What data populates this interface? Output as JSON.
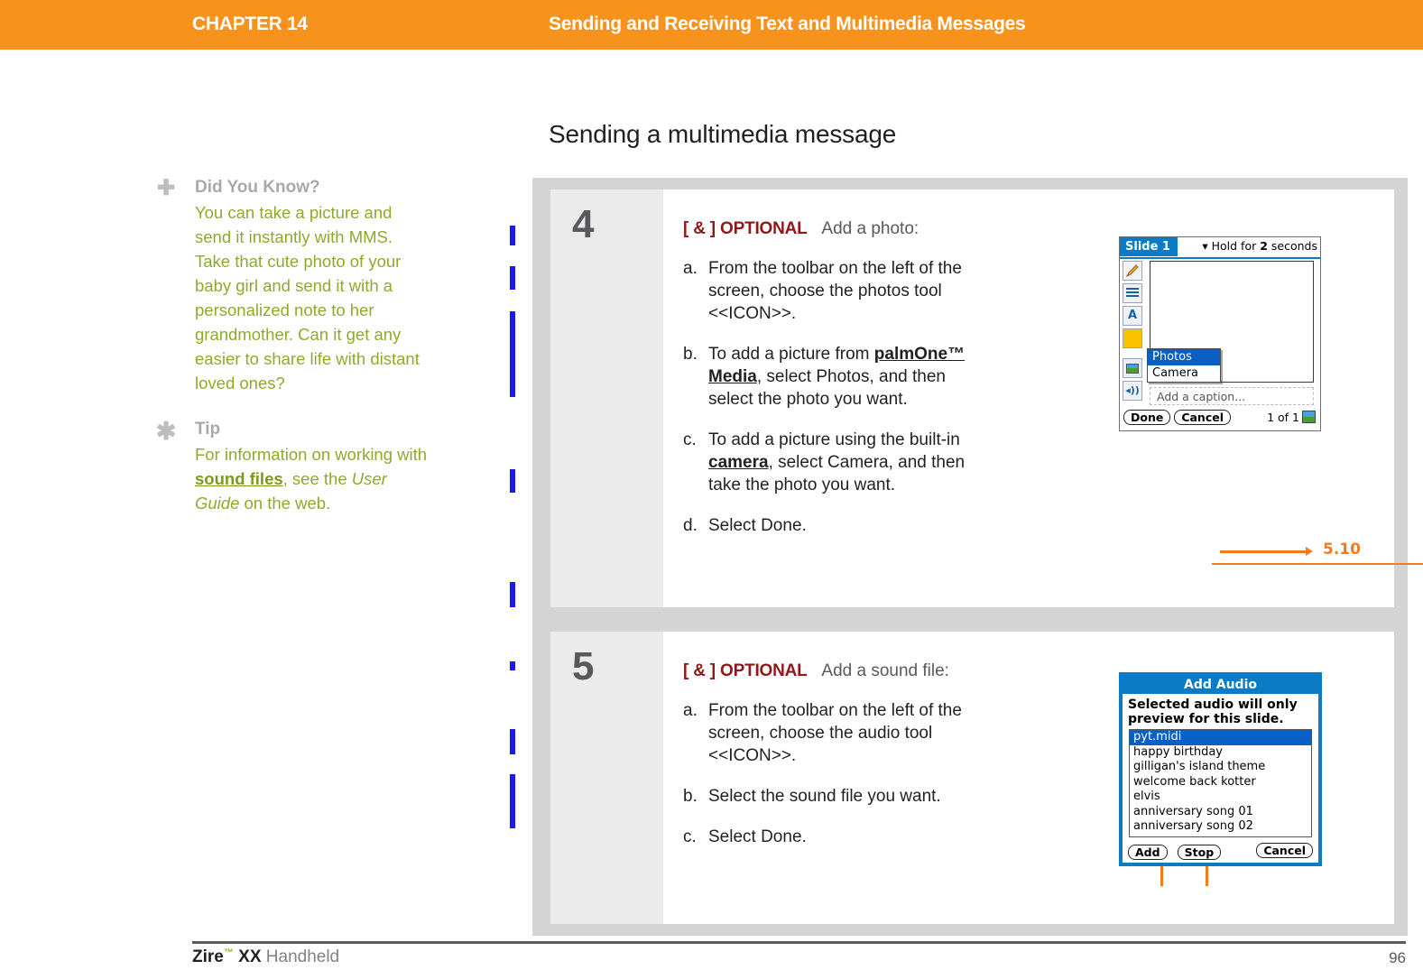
{
  "header": {
    "chapter": "CHAPTER 14",
    "title": "Sending and Receiving Text and Multimedia Messages",
    "band_color": "#f7931d"
  },
  "page_heading": "Sending a multimedia message",
  "sidebar": {
    "notes": [
      {
        "icon": "plus-icon",
        "icon_glyph": "✚",
        "title": "Did You Know?",
        "body_parts": [
          {
            "text": "You can take a picture and send it instantly with MMS. Take that cute photo of your baby girl and send it with a personalized note to her grandmother. Can it get any easier to share life with distant loved ones?",
            "style": "plain"
          }
        ]
      },
      {
        "icon": "asterisk-icon",
        "icon_glyph": "✱",
        "title": "Tip",
        "body_parts": [
          {
            "text": "For information on working with ",
            "style": "plain"
          },
          {
            "text": "sound files",
            "style": "bold-underline"
          },
          {
            "text": ", see the ",
            "style": "plain"
          },
          {
            "text": "User Guide",
            "style": "italic"
          },
          {
            "text": " on the web.",
            "style": "plain"
          }
        ]
      }
    ],
    "text_color": "#8cab2c",
    "title_color": "#a7a9ac"
  },
  "steps": [
    {
      "number": "4",
      "optional_tag": "[ & ] OPTIONAL",
      "optional_desc": "Add a photo:",
      "substeps": [
        {
          "letter": "a.",
          "parts": [
            {
              "text": "From the toolbar on the left of the screen, choose the photos tool <<ICON>>.",
              "style": "plain"
            }
          ]
        },
        {
          "letter": "b.",
          "parts": [
            {
              "text": "To add a picture from ",
              "style": "plain"
            },
            {
              "text": "palmOne™ Media",
              "style": "bold-underline"
            },
            {
              "text": ", select Photos, and then select the photo you want.",
              "style": "plain"
            }
          ]
        },
        {
          "letter": "c.",
          "parts": [
            {
              "text": "To add a picture using the built-in ",
              "style": "plain"
            },
            {
              "text": "camera",
              "style": "bold-underline"
            },
            {
              "text": ", select Camera, and then take the photo you want.",
              "style": "plain"
            }
          ]
        },
        {
          "letter": "d.",
          "parts": [
            {
              "text": "Select Done.",
              "style": "plain"
            }
          ]
        }
      ]
    },
    {
      "number": "5",
      "optional_tag": "[ & ] OPTIONAL",
      "optional_desc": "Add a sound file:",
      "substeps": [
        {
          "letter": "a.",
          "parts": [
            {
              "text": "From the toolbar on the left of the screen, choose the audio tool <<ICON>>.",
              "style": "plain"
            }
          ]
        },
        {
          "letter": "b.",
          "parts": [
            {
              "text": "Select the sound file you want.",
              "style": "plain"
            }
          ]
        },
        {
          "letter": "c.",
          "parts": [
            {
              "text": "Select Done.",
              "style": "plain"
            }
          ]
        }
      ]
    }
  ],
  "slide_dialog": {
    "tab_label": "Slide 1",
    "hold_prefix": "Hold for ",
    "hold_value": "2",
    "hold_suffix": " seconds",
    "dropdown_glyph": "▾",
    "tools": [
      "pencil-tool",
      "lines-tool",
      "text-tool",
      "color-swatch-tool",
      "photo-tool",
      "audio-tool"
    ],
    "text_tool_label": "A",
    "audio_tool_glyph": "◂))",
    "menu_items": [
      "Photos",
      "Camera"
    ],
    "menu_selected": "Photos",
    "caption_placeholder": "Add a caption...",
    "done_label": "Done",
    "cancel_label": "Cancel",
    "page_count": "1 of 1",
    "callout_label": "5.10",
    "callout_color": "#f47b20"
  },
  "audio_dialog": {
    "title": "Add Audio",
    "subtitle_line1": "Selected audio will only",
    "subtitle_line2": "preview for this slide.",
    "items": [
      "pyt.midi",
      "happy birthday",
      "gilligan's island theme",
      "welcome back kotter",
      "elvis",
      "anniversary song 01",
      "anniversary song 02"
    ],
    "selected_item": "pyt.midi",
    "add_label": "Add",
    "stop_label": "Stop",
    "cancel_label": "Cancel"
  },
  "footer": {
    "brand": "Zire",
    "trademark": "™",
    "model": "XX",
    "product": " Handheld",
    "page_number": "96"
  }
}
